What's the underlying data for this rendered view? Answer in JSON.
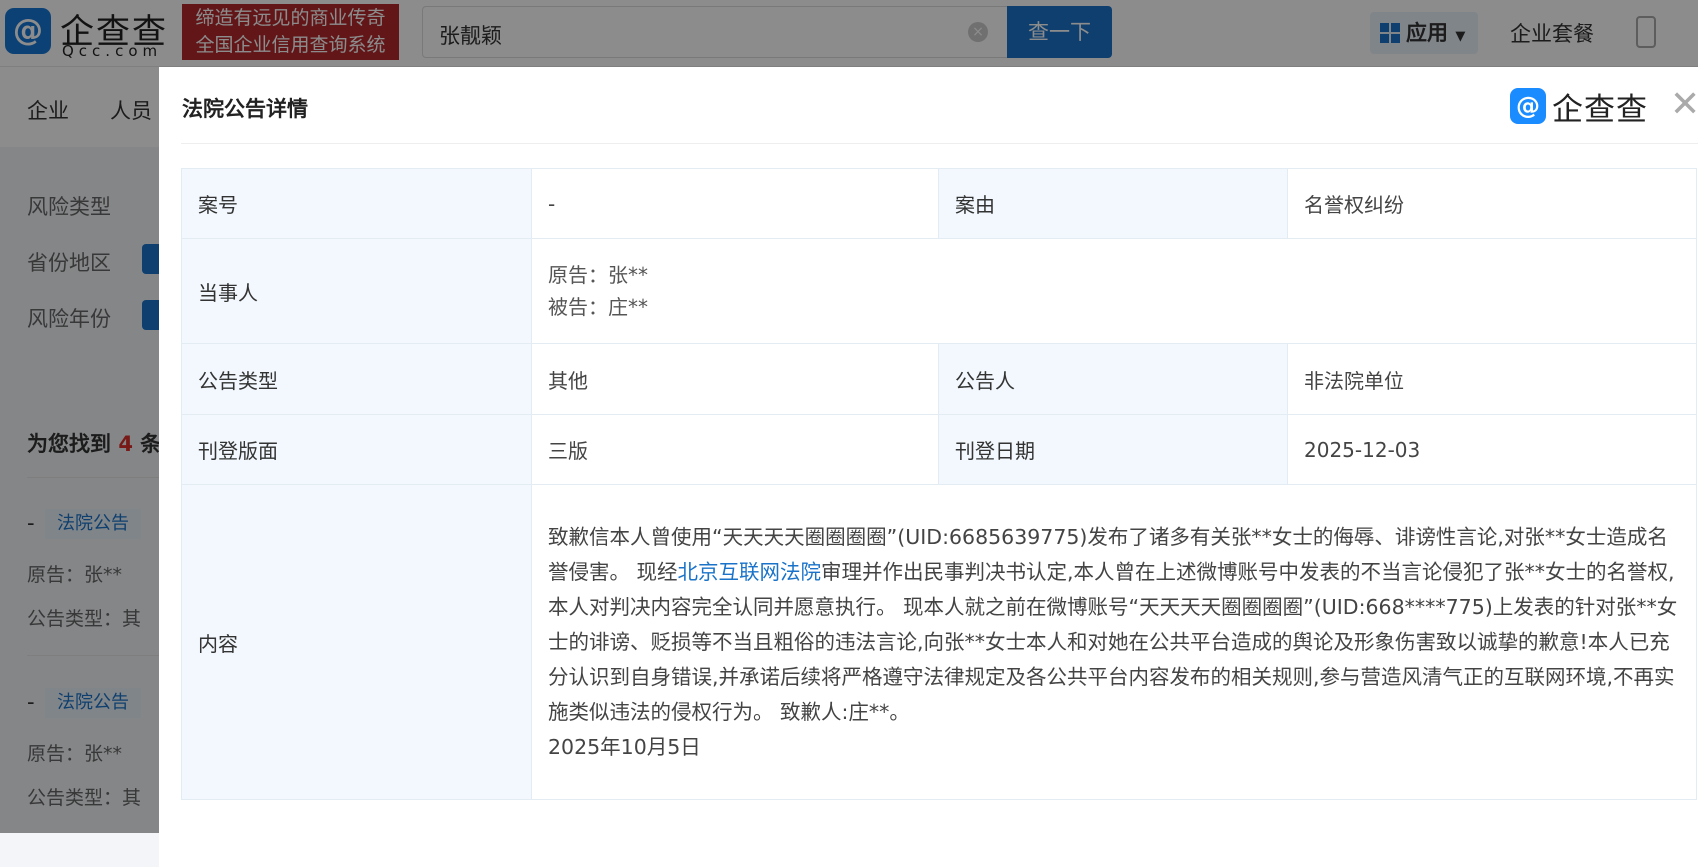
{
  "header": {
    "logo_text": "企查查",
    "logo_sub": "Qcc.com",
    "banner_line1": "缔造有远见的商业传奇",
    "banner_line2": "全国企业信用查询系统",
    "search_value": "张靓颖",
    "search_button": "查一下",
    "apps_label": "应用",
    "package_label": "企业套餐"
  },
  "nav": {
    "items": [
      "企业",
      "人员"
    ]
  },
  "filters": [
    "风险类型",
    "省份地区",
    "风险年份"
  ],
  "results": {
    "prefix": "为您找到",
    "count": "4",
    "suffix": "条",
    "items": [
      {
        "dash": "-",
        "tag": "法院公告",
        "plaintiff": "原告：张**",
        "type": "公告类型：其"
      },
      {
        "dash": "-",
        "tag": "法院公告",
        "plaintiff": "原告：张**",
        "type": "公告类型：其"
      }
    ]
  },
  "modal": {
    "title": "法院公告详情",
    "brand": "企查查",
    "rows": {
      "case_no_label": "案号",
      "case_no": "-",
      "cause_label": "案由",
      "cause": "名誉权纠纷",
      "parties_label": "当事人",
      "plaintiff": "原告：张**",
      "defendant": "被告：庄**",
      "type_label": "公告类型",
      "type": "其他",
      "announcer_label": "公告人",
      "announcer": "非法院单位",
      "page_label": "刊登版面",
      "page": "三版",
      "date_label": "刊登日期",
      "date": "2025-12-03",
      "content_label": "内容"
    },
    "content": {
      "before": "致歉信本人曾使用“天天天天圈圈圈圈”(UID:6685639775)发布了诸多有关张**女士的侮辱、诽谤性言论,对张**女士造成名誉侵害。 现经",
      "link": "北京互联网法院",
      "after": "审理并作出民事判决书认定,本人曾在上述微博账号中发表的不当言论侵犯了张**女士的名誉权,本人对判决内容完全认同并愿意执行。 现本人就之前在微博账号“天天天天圈圈圈圈”(UID:668****775)上发表的针对张**女士的诽谤、贬损等不当且粗俗的违法言论,向张**女士本人和对她在公共平台造成的舆论及形象伤害致以诚挚的歉意!本人已充分认识到自身错误,并承诺后续将严格遵守法律规定及各公共平台内容发布的相关规则,参与营造风清气正的互联网环境,不再实施类似违法的侵权行为。 致歉人:庄**。",
      "date": "2025年10月5日"
    }
  }
}
